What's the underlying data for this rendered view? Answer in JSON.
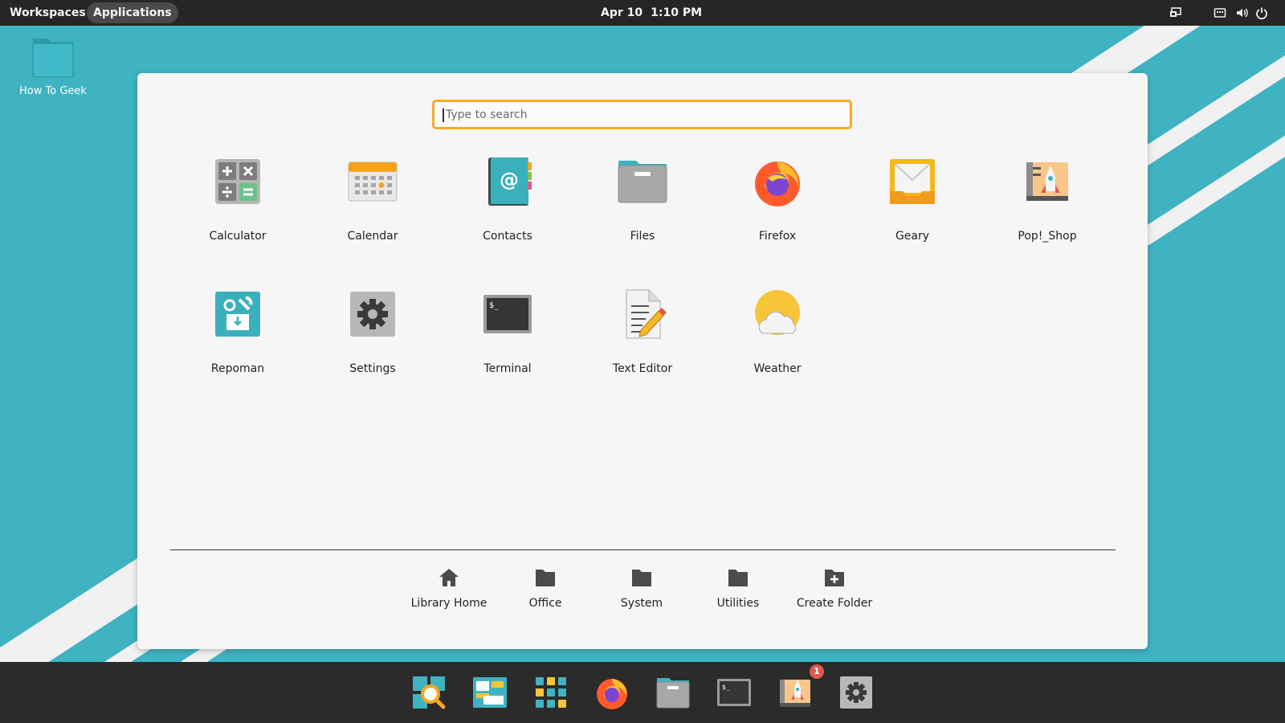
{
  "top_bar": {
    "workspaces": "Workspaces",
    "applications": "Applications",
    "date": "Apr 10",
    "time": "1:10 PM",
    "tray_icons": [
      "display-icon",
      "keyboard-icon",
      "volume-icon",
      "power-icon"
    ]
  },
  "desktop": {
    "folder_label": "How To Geek"
  },
  "launcher": {
    "search_placeholder": "Type to search",
    "apps": [
      {
        "label": "Calculator",
        "icon": "calculator-icon"
      },
      {
        "label": "Calendar",
        "icon": "calendar-icon"
      },
      {
        "label": "Contacts",
        "icon": "contacts-icon"
      },
      {
        "label": "Files",
        "icon": "files-icon"
      },
      {
        "label": "Firefox",
        "icon": "firefox-icon"
      },
      {
        "label": "Geary",
        "icon": "mail-icon"
      },
      {
        "label": "Pop!_Shop",
        "icon": "shop-icon"
      },
      {
        "label": "Repoman",
        "icon": "repoman-icon"
      },
      {
        "label": "Settings",
        "icon": "gear-icon"
      },
      {
        "label": "Terminal",
        "icon": "terminal-icon"
      },
      {
        "label": "Text Editor",
        "icon": "text-editor-icon"
      },
      {
        "label": "Weather",
        "icon": "weather-icon"
      }
    ],
    "categories": [
      {
        "label": "Library Home",
        "icon": "home-icon"
      },
      {
        "label": "Office",
        "icon": "folder-icon"
      },
      {
        "label": "System",
        "icon": "folder-icon"
      },
      {
        "label": "Utilities",
        "icon": "folder-icon"
      },
      {
        "label": "Create Folder",
        "icon": "folder-plus-icon"
      }
    ]
  },
  "dock": {
    "items": [
      "search-icon",
      "workspaces-icon",
      "app-grid-icon",
      "firefox-icon",
      "files-icon",
      "terminal-icon",
      "shop-icon",
      "gear-icon"
    ],
    "shop_badge": "1"
  },
  "colors": {
    "desktop": "#3fb3c2",
    "panel": "#262626",
    "accent": "#f8aa24",
    "badge": "#e0584f"
  }
}
